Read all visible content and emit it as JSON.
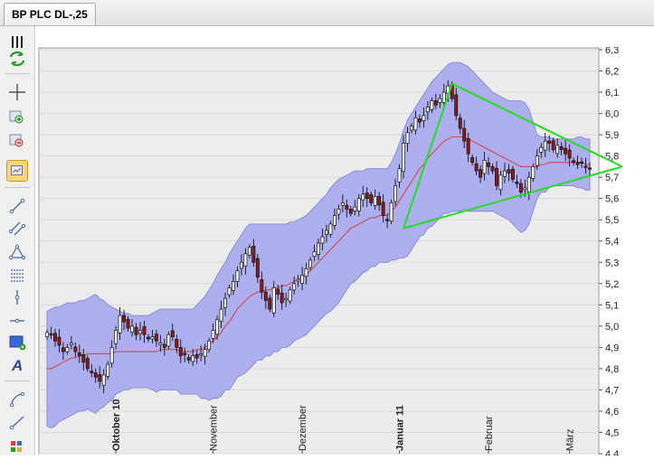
{
  "tab": {
    "title": "BP PLC DL-,25"
  },
  "toolbar": {
    "tools": [
      {
        "name": "bars-icon",
        "active": false
      },
      {
        "name": "refresh-icon",
        "active": false
      },
      {
        "name": "crosshair-icon",
        "active": false
      },
      {
        "name": "zoom-in-icon",
        "active": false
      },
      {
        "name": "zoom-out-icon",
        "active": false
      },
      {
        "name": "chart-settings-icon",
        "active": true
      },
      {
        "name": "line-tool-icon",
        "active": false
      },
      {
        "name": "channel-tool-icon",
        "active": false
      },
      {
        "name": "triangle-tool-icon",
        "active": false
      },
      {
        "name": "fibonacci-icon",
        "active": false
      },
      {
        "name": "vertical-line-icon",
        "active": false
      },
      {
        "name": "horizontal-line-icon",
        "active": false
      },
      {
        "name": "rectangle-tool-icon",
        "active": false
      },
      {
        "name": "text-tool-icon",
        "active": false
      },
      {
        "name": "arc-tool-icon",
        "active": false
      },
      {
        "name": "ray-tool-icon",
        "active": false
      },
      {
        "name": "palette-icon",
        "active": false
      }
    ]
  },
  "chart_data": {
    "type": "candlestick",
    "title": "",
    "ylim": [
      4.4,
      6.3
    ],
    "yticks": [
      "6,3",
      "6,2",
      "6,1",
      "6,0",
      "5,9",
      "5,8",
      "5,7",
      "5,6",
      "5,5",
      "5,4",
      "5,3",
      "5,2",
      "5,1",
      "5,0",
      "4,9",
      "4,8",
      "4,7",
      "4,6",
      "4,5",
      "4,4"
    ],
    "x_labels": [
      {
        "label": "Oktober 10",
        "index": 17,
        "bold": true
      },
      {
        "label": "November",
        "index": 41,
        "bold": false
      },
      {
        "label": "Dezember",
        "index": 63,
        "bold": false
      },
      {
        "label": "Januar 11",
        "index": 87,
        "bold": true
      },
      {
        "label": "Februar",
        "index": 109,
        "bold": false
      },
      {
        "label": "März",
        "index": 129,
        "bold": false
      }
    ],
    "n_candles": 135,
    "close": [
      4.97,
      4.96,
      4.93,
      4.91,
      4.88,
      4.9,
      4.92,
      4.88,
      4.86,
      4.83,
      4.8,
      4.78,
      4.76,
      4.74,
      4.77,
      4.82,
      4.9,
      4.98,
      5.05,
      5.02,
      4.99,
      5.0,
      4.96,
      4.98,
      4.96,
      4.94,
      4.95,
      4.93,
      4.92,
      4.9,
      4.96,
      4.95,
      4.9,
      4.86,
      4.87,
      4.84,
      4.86,
      4.85,
      4.87,
      4.89,
      4.93,
      4.98,
      5.03,
      5.08,
      5.13,
      5.18,
      5.21,
      5.26,
      5.3,
      5.34,
      5.37,
      5.3,
      5.23,
      5.16,
      5.12,
      5.08,
      5.18,
      5.15,
      5.11,
      5.13,
      5.17,
      5.2,
      5.22,
      5.24,
      5.27,
      5.31,
      5.35,
      5.39,
      5.42,
      5.45,
      5.48,
      5.52,
      5.55,
      5.58,
      5.55,
      5.53,
      5.56,
      5.6,
      5.62,
      5.6,
      5.58,
      5.61,
      5.57,
      5.52,
      5.5,
      5.58,
      5.66,
      5.74,
      5.86,
      5.91,
      5.94,
      5.98,
      5.96,
      5.99,
      6.03,
      6.06,
      6.04,
      6.07,
      6.1,
      6.13,
      6.07,
      5.99,
      5.93,
      5.87,
      5.81,
      5.77,
      5.73,
      5.7,
      5.78,
      5.75,
      5.73,
      5.66,
      5.71,
      5.73,
      5.72,
      5.69,
      5.67,
      5.63,
      5.65,
      5.7,
      5.75,
      5.8,
      5.84,
      5.87,
      5.86,
      5.83,
      5.85,
      5.83,
      5.81,
      5.79,
      5.77,
      5.76,
      5.77,
      5.75,
      5.74
    ],
    "bollinger": {
      "upper": [
        5.07,
        5.08,
        5.09,
        5.09,
        5.1,
        5.11,
        5.11,
        5.11,
        5.12,
        5.12,
        5.13,
        5.14,
        5.15,
        5.13,
        5.12,
        5.1,
        5.09,
        5.08,
        5.07,
        5.06,
        5.06,
        5.05,
        5.05,
        5.05,
        5.05,
        5.05,
        5.06,
        5.07,
        5.08,
        5.08,
        5.08,
        5.08,
        5.08,
        5.08,
        5.08,
        5.08,
        5.08,
        5.1,
        5.12,
        5.14,
        5.17,
        5.2,
        5.24,
        5.27,
        5.3,
        5.34,
        5.37,
        5.4,
        5.43,
        5.46,
        5.48,
        5.48,
        5.48,
        5.48,
        5.48,
        5.48,
        5.48,
        5.48,
        5.48,
        5.48,
        5.49,
        5.49,
        5.5,
        5.51,
        5.52,
        5.54,
        5.56,
        5.58,
        5.6,
        5.62,
        5.65,
        5.67,
        5.69,
        5.7,
        5.71,
        5.72,
        5.73,
        5.73,
        5.73,
        5.74,
        5.74,
        5.74,
        5.74,
        5.74,
        5.74,
        5.77,
        5.81,
        5.86,
        5.92,
        5.97,
        6.0,
        6.03,
        6.06,
        6.09,
        6.12,
        6.15,
        6.17,
        6.19,
        6.21,
        6.23,
        6.24,
        6.24,
        6.24,
        6.23,
        6.22,
        6.2,
        6.18,
        6.16,
        6.14,
        6.12,
        6.1,
        6.09,
        6.08,
        6.07,
        6.06,
        6.06,
        6.06,
        6.06,
        6.05,
        6.02,
        5.96,
        5.9,
        5.89,
        5.89,
        5.89,
        5.88,
        5.88,
        5.88,
        5.88,
        5.88,
        5.88,
        5.89,
        5.89,
        5.88,
        5.88
      ],
      "middle": [
        4.8,
        4.8,
        4.81,
        4.82,
        4.83,
        4.84,
        4.85,
        4.85,
        4.86,
        4.86,
        4.87,
        4.87,
        4.87,
        4.87,
        4.87,
        4.87,
        4.87,
        4.88,
        4.88,
        4.88,
        4.88,
        4.88,
        4.88,
        4.88,
        4.88,
        4.88,
        4.88,
        4.88,
        4.89,
        4.89,
        4.89,
        4.89,
        4.89,
        4.88,
        4.88,
        4.88,
        4.88,
        4.89,
        4.89,
        4.9,
        4.91,
        4.93,
        4.95,
        4.97,
        5.0,
        5.02,
        5.05,
        5.08,
        5.1,
        5.12,
        5.14,
        5.15,
        5.16,
        5.16,
        5.17,
        5.17,
        5.18,
        5.18,
        5.19,
        5.19,
        5.2,
        5.21,
        5.22,
        5.23,
        5.24,
        5.26,
        5.28,
        5.3,
        5.32,
        5.34,
        5.36,
        5.38,
        5.4,
        5.42,
        5.44,
        5.46,
        5.47,
        5.48,
        5.49,
        5.5,
        5.51,
        5.51,
        5.52,
        5.52,
        5.52,
        5.54,
        5.56,
        5.59,
        5.62,
        5.65,
        5.68,
        5.71,
        5.74,
        5.76,
        5.79,
        5.81,
        5.83,
        5.85,
        5.87,
        5.88,
        5.89,
        5.89,
        5.89,
        5.89,
        5.88,
        5.87,
        5.86,
        5.85,
        5.84,
        5.83,
        5.82,
        5.81,
        5.8,
        5.79,
        5.78,
        5.77,
        5.76,
        5.75,
        5.75,
        5.75,
        5.75,
        5.75,
        5.76,
        5.76,
        5.77,
        5.77,
        5.77,
        5.77,
        5.77,
        5.77,
        5.77,
        5.77,
        5.77,
        5.76,
        5.76
      ],
      "lower": [
        4.53,
        4.52,
        4.53,
        4.55,
        4.56,
        4.57,
        4.58,
        4.59,
        4.6,
        4.6,
        4.61,
        4.6,
        4.59,
        4.61,
        4.62,
        4.64,
        4.65,
        4.68,
        4.69,
        4.7,
        4.7,
        4.71,
        4.71,
        4.71,
        4.71,
        4.71,
        4.7,
        4.69,
        4.7,
        4.7,
        4.7,
        4.7,
        4.7,
        4.68,
        4.68,
        4.68,
        4.68,
        4.68,
        4.66,
        4.66,
        4.65,
        4.66,
        4.66,
        4.67,
        4.7,
        4.7,
        4.73,
        4.76,
        4.77,
        4.78,
        4.8,
        4.82,
        4.84,
        4.84,
        4.86,
        4.86,
        4.88,
        4.88,
        4.9,
        4.9,
        4.91,
        4.93,
        4.94,
        4.95,
        4.96,
        4.98,
        5.0,
        5.02,
        5.04,
        5.06,
        5.07,
        5.09,
        5.11,
        5.14,
        5.17,
        5.2,
        5.21,
        5.23,
        5.25,
        5.26,
        5.28,
        5.28,
        5.3,
        5.3,
        5.3,
        5.31,
        5.31,
        5.32,
        5.32,
        5.33,
        5.36,
        5.39,
        5.42,
        5.43,
        5.46,
        5.47,
        5.49,
        5.51,
        5.53,
        5.53,
        5.54,
        5.54,
        5.54,
        5.55,
        5.54,
        5.54,
        5.54,
        5.54,
        5.54,
        5.54,
        5.54,
        5.53,
        5.52,
        5.51,
        5.5,
        5.48,
        5.46,
        5.44,
        5.45,
        5.48,
        5.54,
        5.6,
        5.63,
        5.63,
        5.65,
        5.66,
        5.66,
        5.66,
        5.66,
        5.66,
        5.66,
        5.65,
        5.65,
        5.64,
        5.64
      ]
    },
    "trendlines": [
      {
        "from": [
          88,
          5.46
        ],
        "to": [
          100,
          6.14
        ]
      },
      {
        "from": [
          100,
          6.14
        ],
        "to": [
          142,
          5.75
        ]
      },
      {
        "from": [
          88,
          5.46
        ],
        "to": [
          142,
          5.75
        ]
      }
    ],
    "colors": {
      "band": "#a7a8f0",
      "band_edge": "#7e80cc",
      "middle": "#d04848",
      "trend": "#22dd22",
      "up": "#ffffff",
      "down": "#8b1a1a",
      "grid": "#d8d8d8",
      "plot_bg": "#ececec"
    }
  }
}
